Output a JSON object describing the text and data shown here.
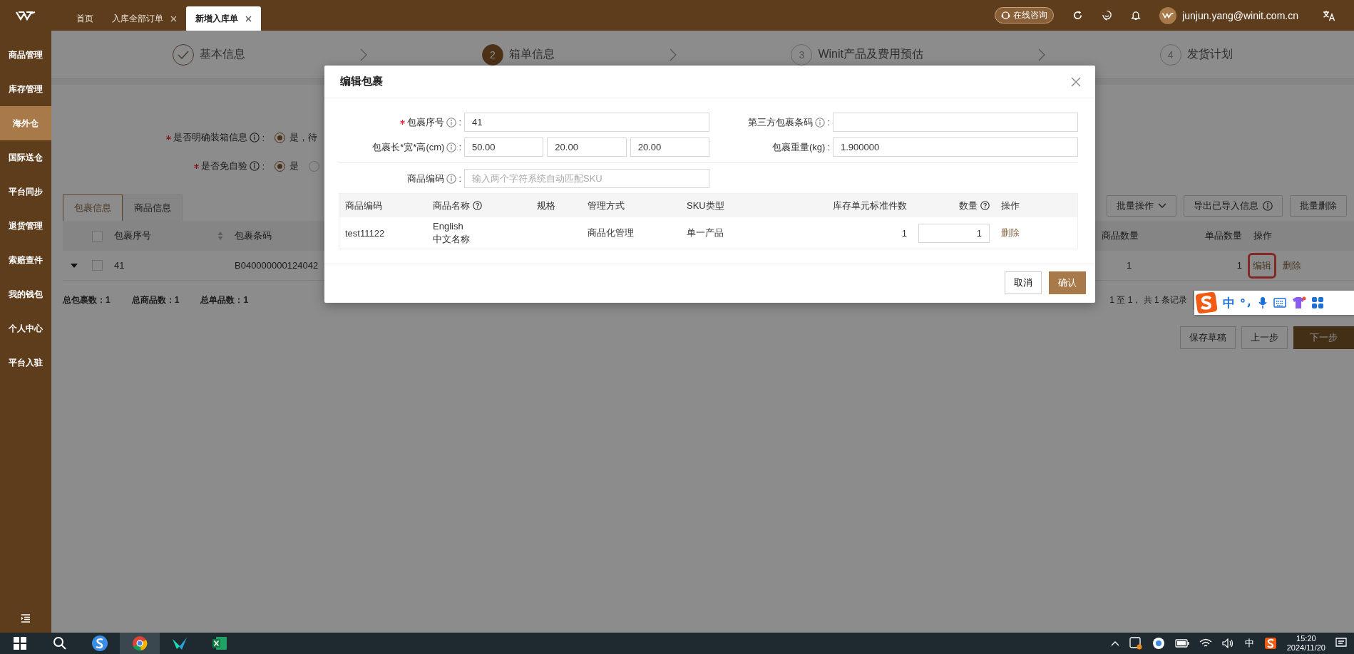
{
  "header": {
    "tabs": [
      {
        "label": "首页",
        "closable": false,
        "selected": false
      },
      {
        "label": "入库全部订单",
        "closable": true,
        "selected": false
      },
      {
        "label": "新增入库单",
        "closable": true,
        "selected": true
      }
    ],
    "consult_button": "在线咨询",
    "user_email": "junjun.yang@winit.com.cn"
  },
  "sidebar": {
    "items": [
      {
        "label": "商品管理",
        "selected": false
      },
      {
        "label": "库存管理",
        "selected": false
      },
      {
        "label": "海外仓",
        "selected": true
      },
      {
        "label": "国际送仓",
        "selected": false
      },
      {
        "label": "平台同步",
        "selected": false
      },
      {
        "label": "退货管理",
        "selected": false
      },
      {
        "label": "索赔查件",
        "selected": false
      },
      {
        "label": "我的钱包",
        "selected": false
      },
      {
        "label": "个人中心",
        "selected": false
      },
      {
        "label": "平台入驻",
        "selected": false
      }
    ]
  },
  "steps": [
    {
      "label": "基本信息",
      "completed": true,
      "selected": false
    },
    {
      "number": "2",
      "label": "箱单信息",
      "completed": false,
      "selected": true
    },
    {
      "number": "3",
      "label": "Winit产品及费用预估",
      "completed": false,
      "selected": false
    },
    {
      "number": "4",
      "label": "发货计划",
      "completed": false,
      "selected": false
    }
  ],
  "form": [
    {
      "label": "是否明确装箱信息",
      "required": true,
      "info": true,
      "colon": ":",
      "options": [
        {
          "label": "是，待",
          "selected": true
        }
      ]
    },
    {
      "label": "是否免自验",
      "required": true,
      "info": true,
      "colon": ":",
      "options": [
        {
          "label": "是",
          "selected": true
        },
        {
          "selected": false
        }
      ]
    }
  ],
  "content_tabs": [
    {
      "label": "包裹信息",
      "selected": true
    },
    {
      "label": "商品信息",
      "selected": false
    }
  ],
  "toolbar": [
    {
      "label": "批量操作",
      "kind": "dropdown"
    },
    {
      "label": "导出已导入信息",
      "kind": "info"
    },
    {
      "label": "批量删除",
      "kind": "plain"
    }
  ],
  "package_table": {
    "header_checked": false,
    "columns_left": [
      "包裹序号",
      "包裹条码"
    ],
    "columns_right": [
      "商品数量",
      "单品数量",
      "操作"
    ],
    "rows": [
      {
        "expanded": true,
        "checked": false,
        "number": "41",
        "barcode": "B040000000124042",
        "product_qty": "1",
        "item_qty": "1",
        "actions": [
          {
            "label": "编辑",
            "highlighted": true
          },
          {
            "label": "删除",
            "highlighted": false
          }
        ]
      }
    ]
  },
  "summary": [
    "总包裹数：1",
    "总商品数：1",
    "总单品数：1"
  ],
  "pagination": {
    "text": "1 至 1， 共 1 条记录"
  },
  "footer_buttons": [
    {
      "label": "保存草稿",
      "primary": false
    },
    {
      "label": "上一步",
      "primary": false
    },
    {
      "label": "下一步",
      "primary": true
    }
  ],
  "modal": {
    "title": "编辑包裹",
    "fields": [
      {
        "label": "包裹序号",
        "required": true,
        "info": true,
        "colon": ":",
        "values": [
          "41"
        ]
      },
      {
        "label": "第三方包裹条码",
        "required": false,
        "info": true,
        "colon": ":"
      },
      {
        "label": "包裹长*宽*高(cm)",
        "required": false,
        "info": true,
        "colon": ":",
        "values": [
          "50.00",
          "20.00",
          "20.00"
        ]
      },
      {
        "label": "包裹重量(kg)",
        "required": false,
        "info": false,
        "colon": ":",
        "values": [
          "1.900000"
        ]
      }
    ],
    "search": {
      "label": "商品编码",
      "info": true,
      "colon": ":",
      "placeholder": "输入两个字符系统自动匹配SKU"
    },
    "table": {
      "columns": [
        {
          "label": "商品编码",
          "help": false
        },
        {
          "label": "商品名称",
          "help": true
        },
        {
          "label": "规格",
          "help": false
        },
        {
          "label": "管理方式",
          "help": false
        },
        {
          "label": "SKU类型",
          "help": false
        },
        {
          "label": "库存单元标准件数",
          "help": false
        },
        {
          "label": "数量",
          "help": true
        },
        {
          "label": "操作",
          "help": false
        }
      ],
      "rows": [
        {
          "code": "test11122",
          "name_lines": [
            "English",
            "中文名称"
          ],
          "management": "商品化管理",
          "sku_type": "单一产品",
          "standard_count": "1",
          "quantity": "1",
          "action": "删除"
        }
      ]
    },
    "buttons": [
      {
        "label": "取消",
        "primary": false
      },
      {
        "label": "确认",
        "primary": true
      }
    ]
  },
  "ime_bar": {
    "mode": "中"
  },
  "taskbar": {
    "input_indicator": "中",
    "time": "15:20",
    "date": "2024/11/20"
  }
}
